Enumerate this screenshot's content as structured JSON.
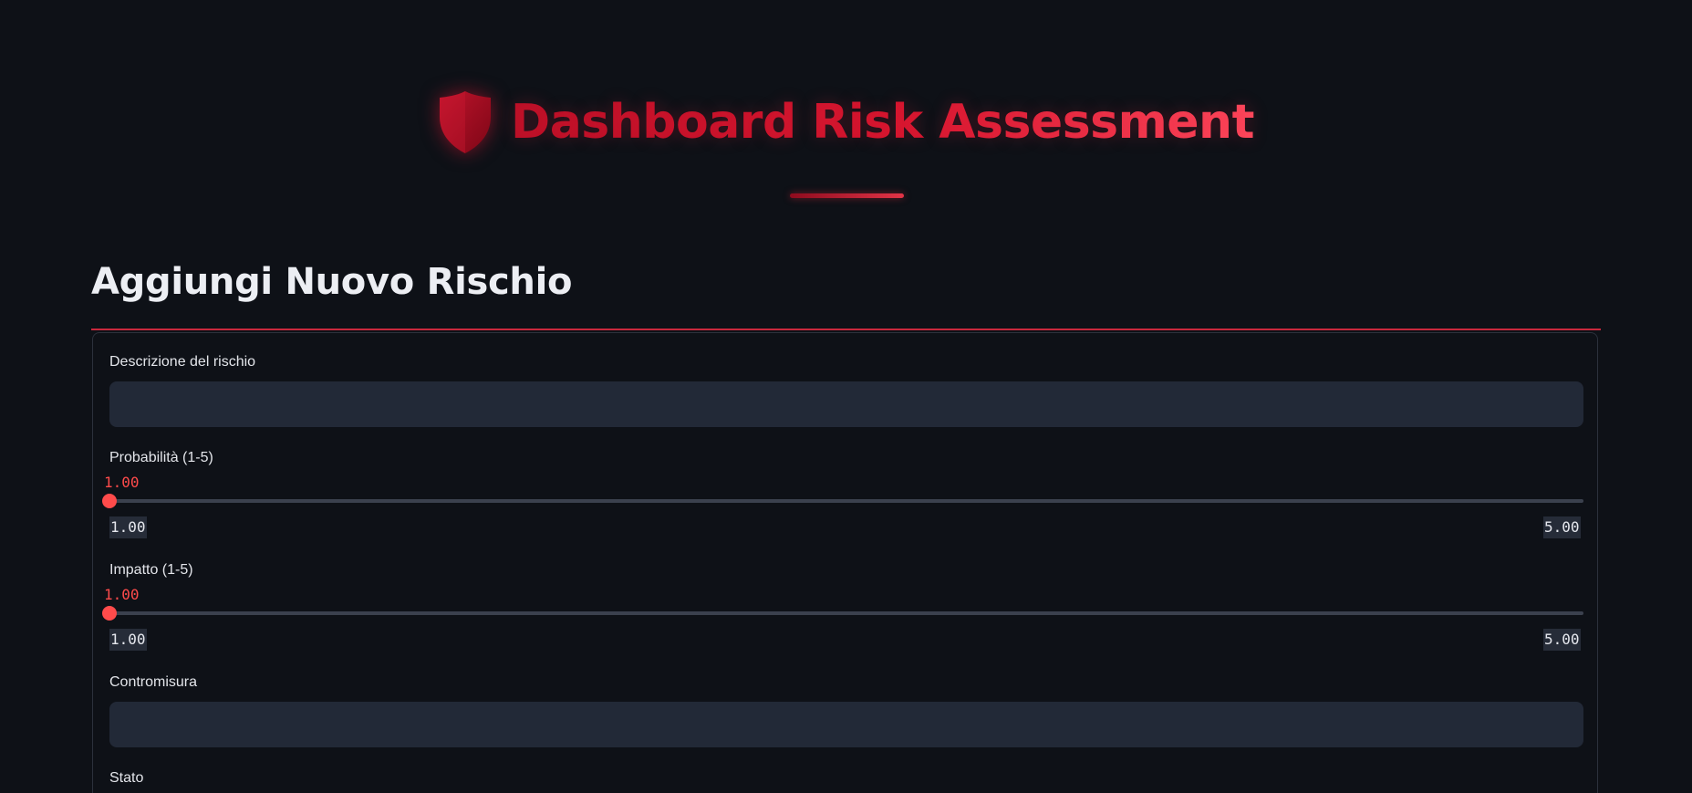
{
  "header": {
    "title": "Dashboard Risk Assessment",
    "icon": "shield-icon",
    "accent_color": "#d6162f"
  },
  "section": {
    "title": "Aggiungi Nuovo Rischio"
  },
  "form": {
    "description": {
      "label": "Descrizione del rischio",
      "value": "",
      "placeholder": ""
    },
    "probability": {
      "label": "Probabilità (1-5)",
      "value": "1.00",
      "min": "1.00",
      "max": "5.00",
      "fraction": 0
    },
    "impact": {
      "label": "Impatto (1-5)",
      "value": "1.00",
      "min": "1.00",
      "max": "5.00",
      "fraction": 0
    },
    "countermeasure": {
      "label": "Contromisura",
      "value": "",
      "placeholder": ""
    },
    "status": {
      "label": "Stato"
    }
  },
  "colors": {
    "background": "#0e1117",
    "input_background": "#222937",
    "slider_accent": "#ff4b4b",
    "section_rule": "#c8283c"
  }
}
